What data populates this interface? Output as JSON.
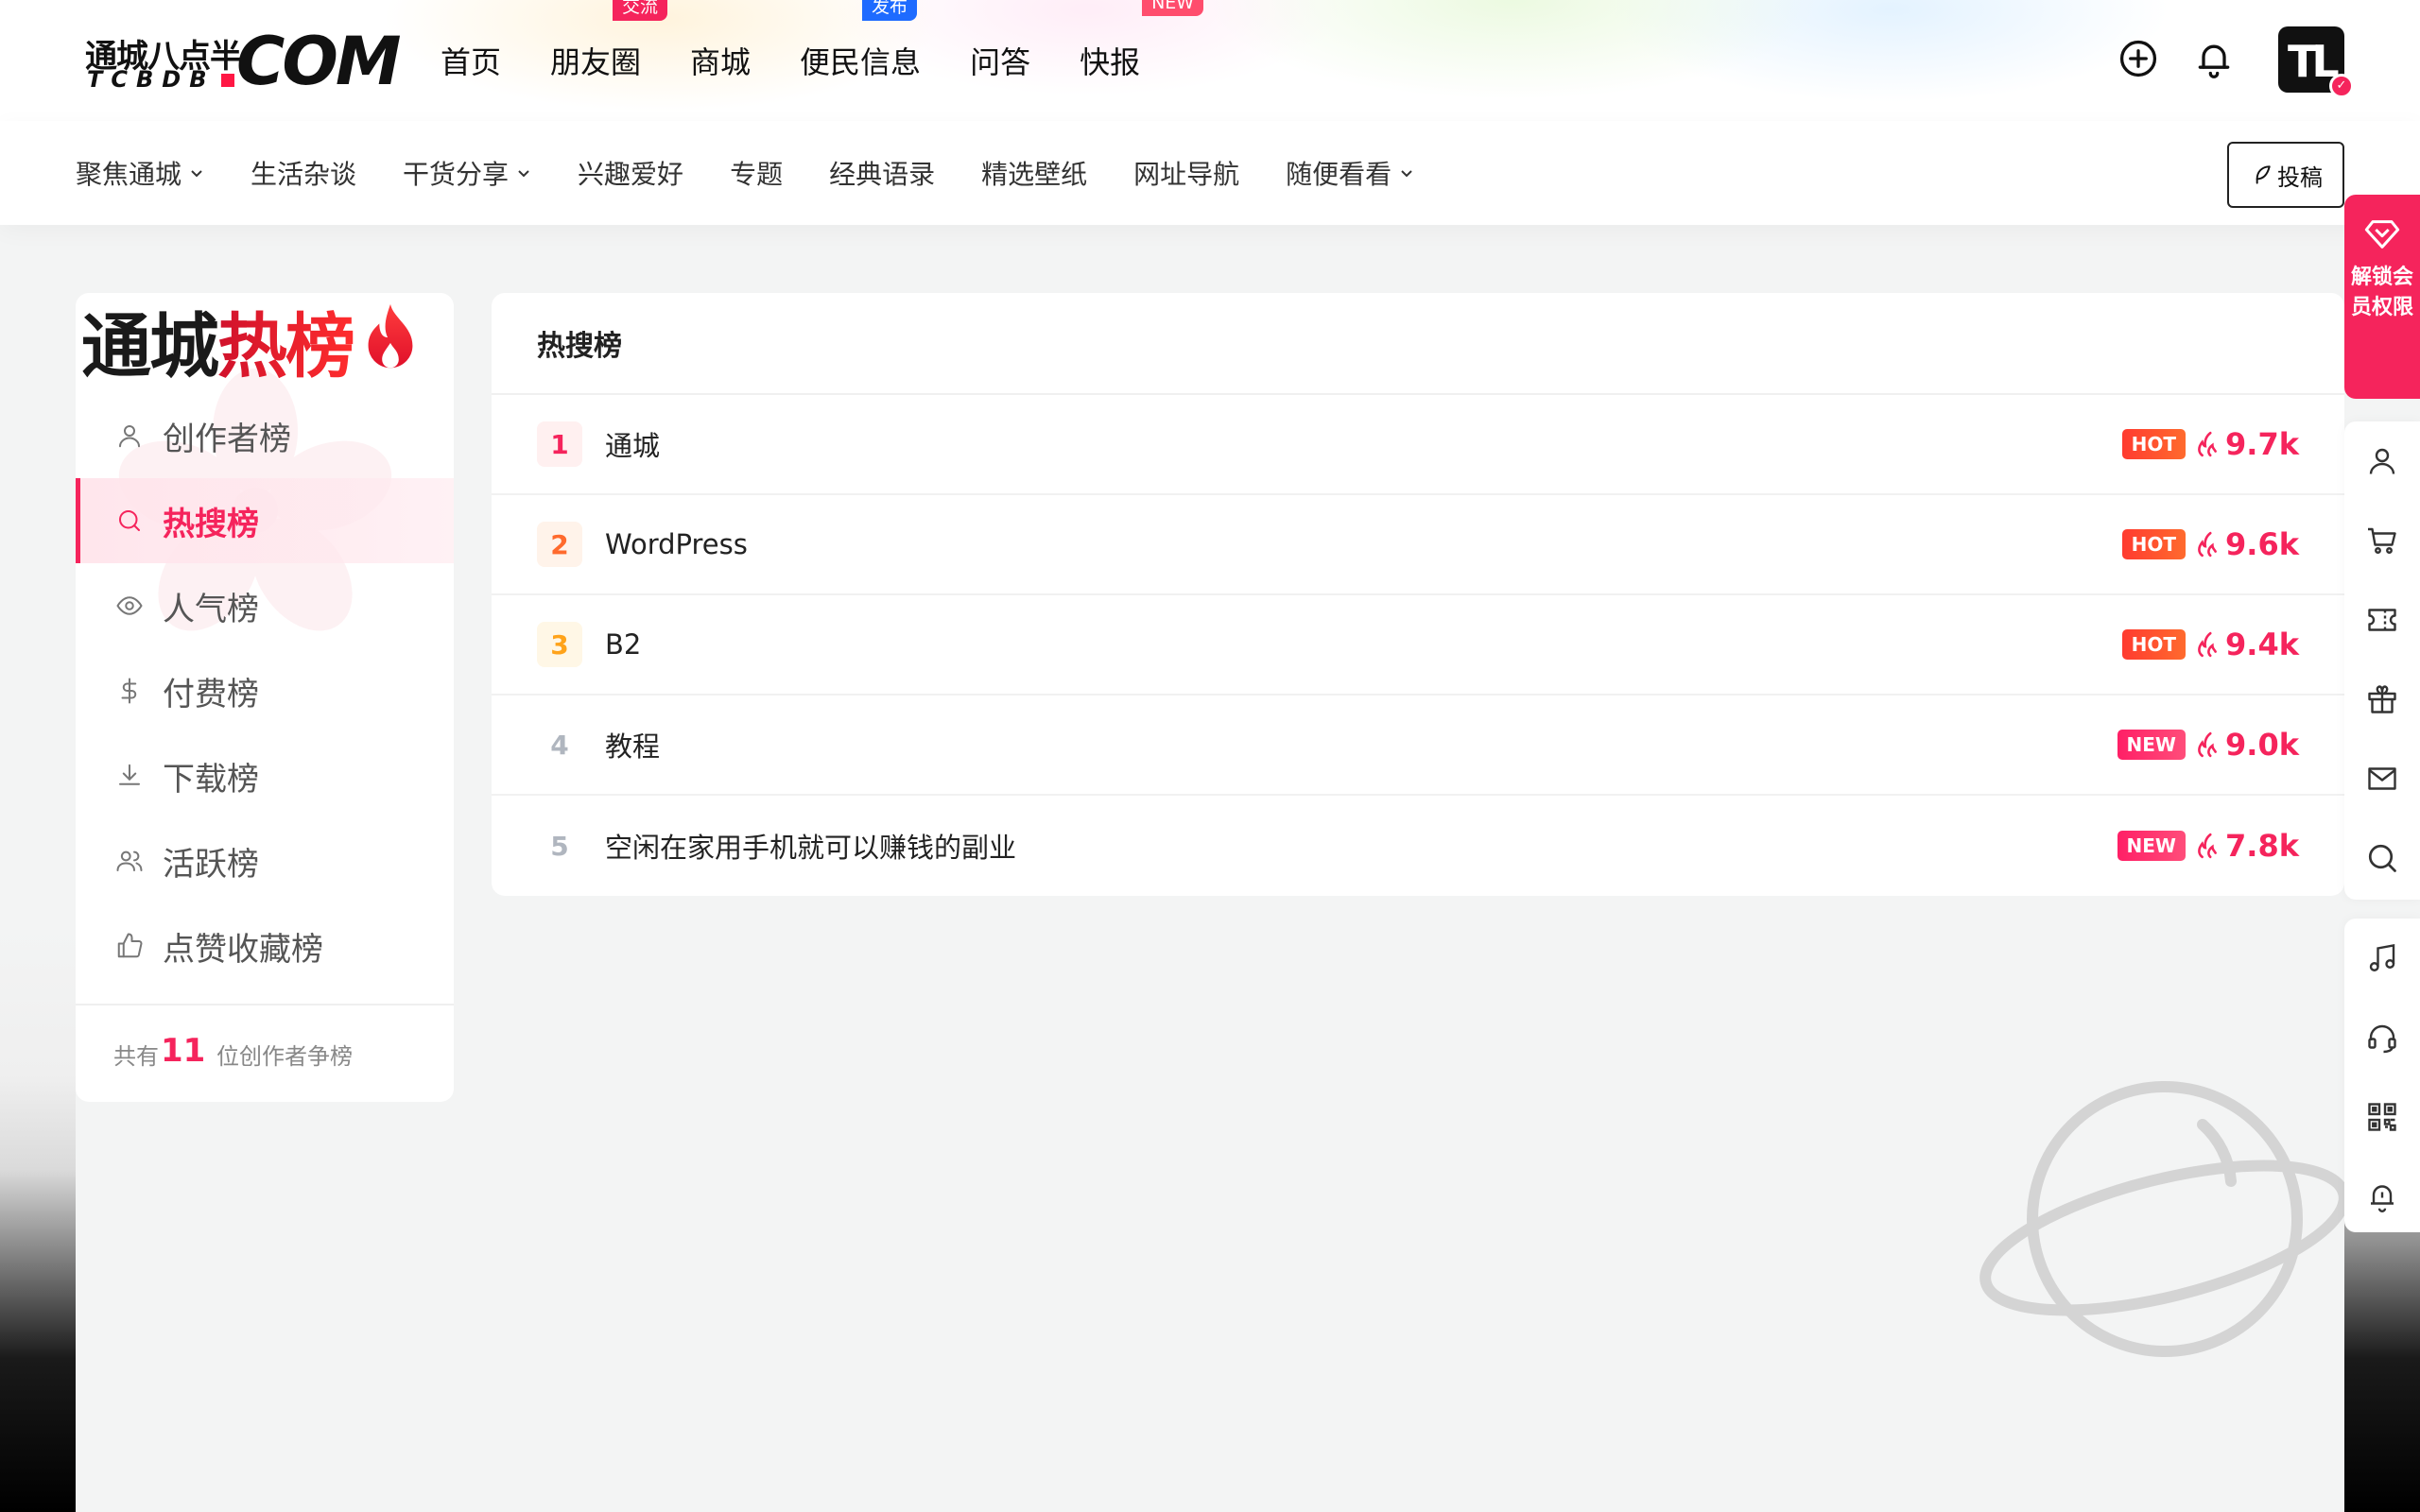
{
  "site": {
    "logo_cn": "通城八点半",
    "logo_en": "TCBDB",
    "logo_com": "COM"
  },
  "main_nav": [
    {
      "label": "首页",
      "badge": null
    },
    {
      "label": "朋友圈",
      "badge": "交流",
      "badge_color": "#f5245c"
    },
    {
      "label": "商城",
      "badge": null
    },
    {
      "label": "便民信息",
      "badge": "发布",
      "badge_color": "#1e6bff"
    },
    {
      "label": "问答",
      "badge": null
    },
    {
      "label": "快报",
      "badge": "NEW",
      "badge_color": "#ff4d6d"
    }
  ],
  "header_icons": [
    "plus-circle-icon",
    "bell-icon",
    "user-avatar"
  ],
  "sub_nav": [
    {
      "label": "聚焦通城",
      "dropdown": true
    },
    {
      "label": "生活杂谈",
      "dropdown": false
    },
    {
      "label": "干货分享",
      "dropdown": true
    },
    {
      "label": "兴趣爱好",
      "dropdown": false
    },
    {
      "label": "专题",
      "dropdown": false
    },
    {
      "label": "经典语录",
      "dropdown": false
    },
    {
      "label": "精选壁纸",
      "dropdown": false
    },
    {
      "label": "网址导航",
      "dropdown": false
    },
    {
      "label": "随便看看",
      "dropdown": true
    }
  ],
  "submit_label": "投稿",
  "left_panel": {
    "title_dark": "通城",
    "title_red": "热榜",
    "menu": [
      {
        "label": "创作者榜",
        "icon": "user-icon",
        "active": false
      },
      {
        "label": "热搜榜",
        "icon": "search-icon",
        "active": true
      },
      {
        "label": "人气榜",
        "icon": "eye-icon",
        "active": false
      },
      {
        "label": "付费榜",
        "icon": "dollar-icon",
        "active": false
      },
      {
        "label": "下载榜",
        "icon": "download-icon",
        "active": false
      },
      {
        "label": "活跃榜",
        "icon": "users-icon",
        "active": false
      },
      {
        "label": "点赞收藏榜",
        "icon": "thumbs-up-icon",
        "active": false
      }
    ],
    "footer_prefix": "共有",
    "footer_count": "11",
    "footer_suffix": " 位创作者争榜"
  },
  "main_panel": {
    "title": "热搜榜",
    "rows": [
      {
        "rank": "1",
        "title": "通城",
        "tag": "HOT",
        "heat": "9.7k"
      },
      {
        "rank": "2",
        "title": "WordPress",
        "tag": "HOT",
        "heat": "9.6k"
      },
      {
        "rank": "3",
        "title": "B2",
        "tag": "HOT",
        "heat": "9.4k"
      },
      {
        "rank": "4",
        "title": "教程",
        "tag": "NEW",
        "heat": "9.0k"
      },
      {
        "rank": "5",
        "title": "空闲在家用手机就可以赚钱的副业",
        "tag": "NEW",
        "heat": "7.8k"
      }
    ]
  },
  "side_bar": {
    "vip_label": "解锁会员权限",
    "group1": [
      "user-icon",
      "cart-icon",
      "ticket-icon",
      "gift-icon",
      "mail-icon",
      "search-icon"
    ],
    "group2": [
      "music-icon",
      "headset-icon",
      "qrcode-icon",
      "bell-icon"
    ]
  },
  "colors": {
    "accent": "#f5245c",
    "rank1_bg": "#fff0f0",
    "rank1_fg": "#f5245c",
    "rank2_bg": "#fff3ea",
    "rank2_fg": "#ff6a2d",
    "rank3_bg": "#fff7e6",
    "rank3_fg": "#ffa31a",
    "rank_other_fg": "#b0b6bf"
  }
}
